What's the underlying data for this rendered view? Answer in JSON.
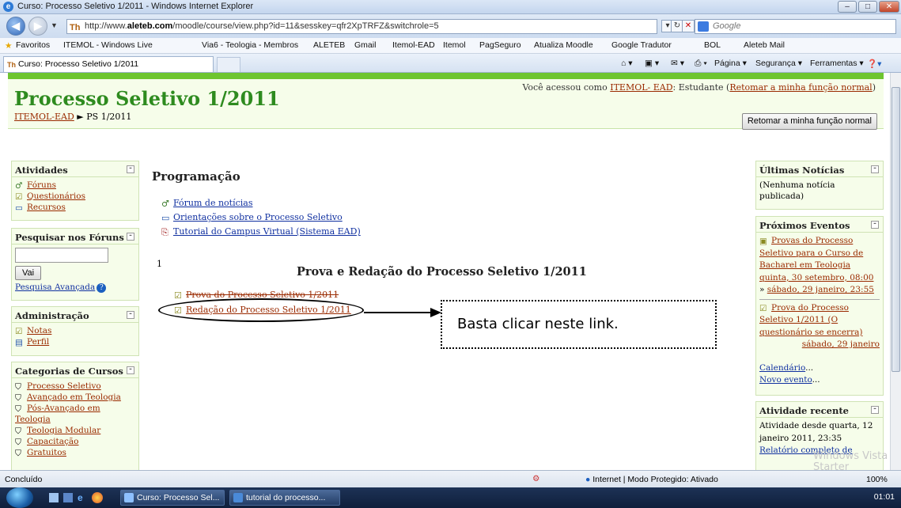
{
  "window": {
    "title": "Curso: Processo Seletivo 1/2011 - Windows Internet Explorer",
    "min": "–",
    "max": "□",
    "close": "✕"
  },
  "address": {
    "url_prefix": "http://www.",
    "url_domain": "aleteb.com",
    "url_rest": "/moodle/course/view.php?id=11&sesskey=qfr2XpTRFZ&switchrole=5",
    "search_placeholder": "Google"
  },
  "favorites": {
    "label": "Favoritos",
    "items": [
      "ITEMOL - Windows Live",
      "Via6 - Teologia - Membros",
      "ALETEB",
      "Gmail",
      "Itemol-EAD",
      "Itemol",
      "PagSeguro",
      "Atualiza Moodle",
      "Google Tradutor",
      "BOL",
      "Aleteb Mail"
    ]
  },
  "tabs": {
    "active": "Curso: Processo Seletivo 1/2011",
    "commands": [
      "Página ▾",
      "Segurança ▾",
      "Ferramentas ▾"
    ]
  },
  "page": {
    "course_title": "Processo Seletivo 1/2011",
    "login_prefix": "Você acessou como ",
    "login_user": "ITEMOL- EAD",
    "login_role": ": Estudante (",
    "login_return": "Retomar a minha função normal",
    "login_close": ")",
    "crumb_home": "ITEMOL-EAD",
    "crumb_sep": " ► ",
    "crumb_current": "PS 1/2011",
    "return_button": "Retomar a minha função normal"
  },
  "left": {
    "activities": {
      "title": "Atividades",
      "items": [
        "Fóruns",
        "Questionários",
        "Recursos"
      ]
    },
    "search": {
      "title": "Pesquisar nos Fóruns",
      "button": "Vai",
      "advanced": "Pesquisa Avançada"
    },
    "admin": {
      "title": "Administração",
      "items": [
        "Notas",
        "Perfil"
      ]
    },
    "categories": {
      "title": "Categorias de Cursos",
      "items": [
        "Processo Seletivo",
        "Avançado em Teologia",
        "Pós-Avançado em Teologia",
        "Teologia Modular",
        "Capacitação",
        "Gratuitos"
      ]
    }
  },
  "main": {
    "section0_title": "Programação",
    "section0_links": [
      "Fórum de notícias",
      "Orientações sobre o Processo Seletivo",
      "Tutorial do Campus Virtual (Sistema EAD)"
    ],
    "section1_number": "1",
    "section1_title": "Prova e Redação do Processo Seletivo 1/2011",
    "section1_links": [
      "Prova do Processo Seletivo 1/2011",
      "Redação do Processo Seletivo 1/2011"
    ],
    "callout": "Basta clicar neste link."
  },
  "right": {
    "news": {
      "title": "Últimas Notícias",
      "body": "(Nenhuma notícia publicada)"
    },
    "events": {
      "title": "Próximos Eventos",
      "event1": "Provas do Processo Seletivo para o Curso de Bacharel em Teologia",
      "event1_when": "quinta, 30 setembro, 08:00",
      "event1_arrow": "» ",
      "event1_until": "sábado, 29 janeiro, 23:55",
      "event2": "Prova do Processo Seletivo 1/2011 (O questionário se encerra)",
      "event2_when": "sábado, 29 janeiro",
      "calendar": "Calendário",
      "new_event": "Novo evento",
      "ellipsis": "..."
    },
    "recent": {
      "title": "Atividade recente",
      "body": "Atividade desde quarta, 12 janeiro 2011, 23:35",
      "report": "Relatório completo de"
    }
  },
  "status": {
    "text": "Concluído",
    "zone": "Internet | Modo Protegido: Ativado",
    "zoom": "100%"
  },
  "taskbar": {
    "tasks": [
      "Curso: Processo Sel...",
      "tutorial do processo..."
    ],
    "clock": "01:01"
  },
  "watermark": "Windows Vista\nStarter"
}
